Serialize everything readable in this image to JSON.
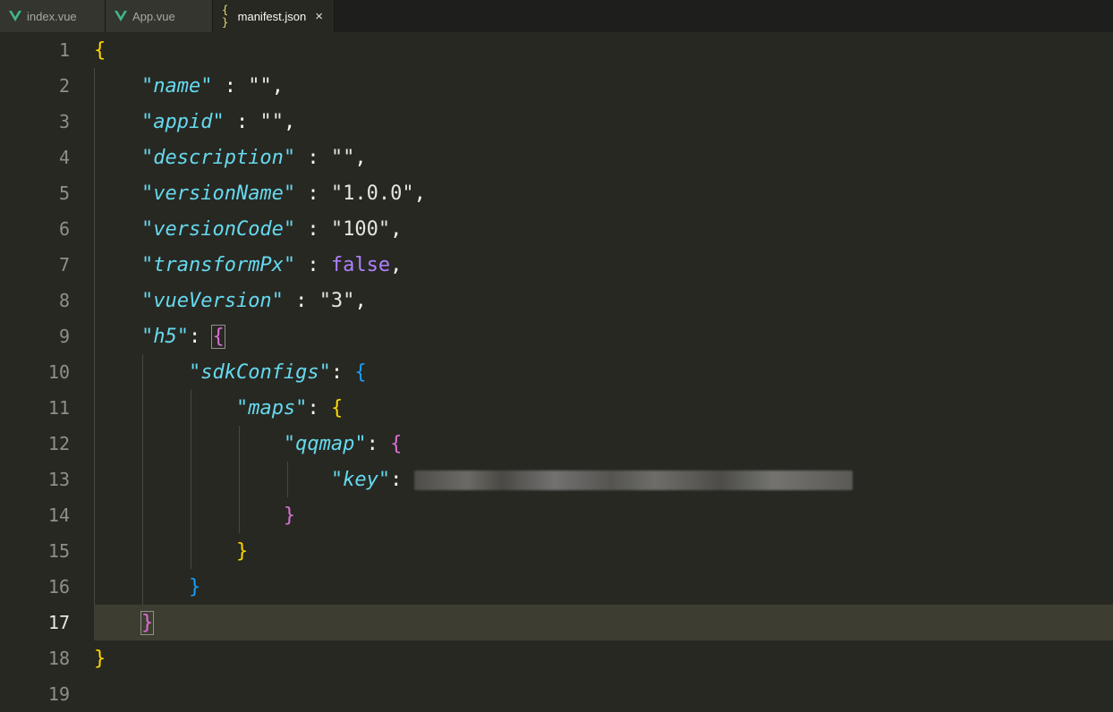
{
  "tabs": [
    {
      "label": "index.vue",
      "icon": "vue-icon"
    },
    {
      "label": "App.vue",
      "icon": "vue-icon"
    },
    {
      "label": "manifest.json",
      "icon": "json-braces-icon",
      "active": true
    }
  ],
  "tab_close_glyph": "×",
  "json_icon_glyph": "{ }",
  "editor": {
    "current_line": 17,
    "lines": [
      {
        "n": "1"
      },
      {
        "n": "2"
      },
      {
        "n": "3"
      },
      {
        "n": "4"
      },
      {
        "n": "5"
      },
      {
        "n": "6"
      },
      {
        "n": "7"
      },
      {
        "n": "8"
      },
      {
        "n": "9"
      },
      {
        "n": "10"
      },
      {
        "n": "11"
      },
      {
        "n": "12"
      },
      {
        "n": "13"
      },
      {
        "n": "14"
      },
      {
        "n": "15"
      },
      {
        "n": "16"
      },
      {
        "n": "17"
      },
      {
        "n": "18"
      },
      {
        "n": "19"
      }
    ],
    "tokens": {
      "open_root": "{",
      "k_name": "\"name\"",
      "v_name": "\"\"",
      "k_appid": "\"appid\"",
      "v_appid": "\"\"",
      "k_description": "\"description\"",
      "v_description": "\"\"",
      "k_versionName": "\"versionName\"",
      "v_versionName": "\"1.0.0\"",
      "k_versionCode": "\"versionCode\"",
      "v_versionCode": "\"100\"",
      "k_transformPx": "\"transformPx\"",
      "v_transformPx": "false",
      "k_vueVersion": "\"vueVersion\"",
      "v_vueVersion": "\"3\"",
      "k_h5": "\"h5\"",
      "k_sdkConfigs": "\"sdkConfigs\"",
      "k_maps": "\"maps\"",
      "k_qqmap": "\"qqmap\"",
      "k_key": "\"key\"",
      "close_root": "}"
    }
  },
  "colors": {
    "background": "#272822",
    "key": "#66d9ef",
    "bool": "#ae81ff",
    "bracket_yellow": "#ffd700",
    "bracket_pink": "#da70d6",
    "bracket_blue": "#179fff"
  }
}
